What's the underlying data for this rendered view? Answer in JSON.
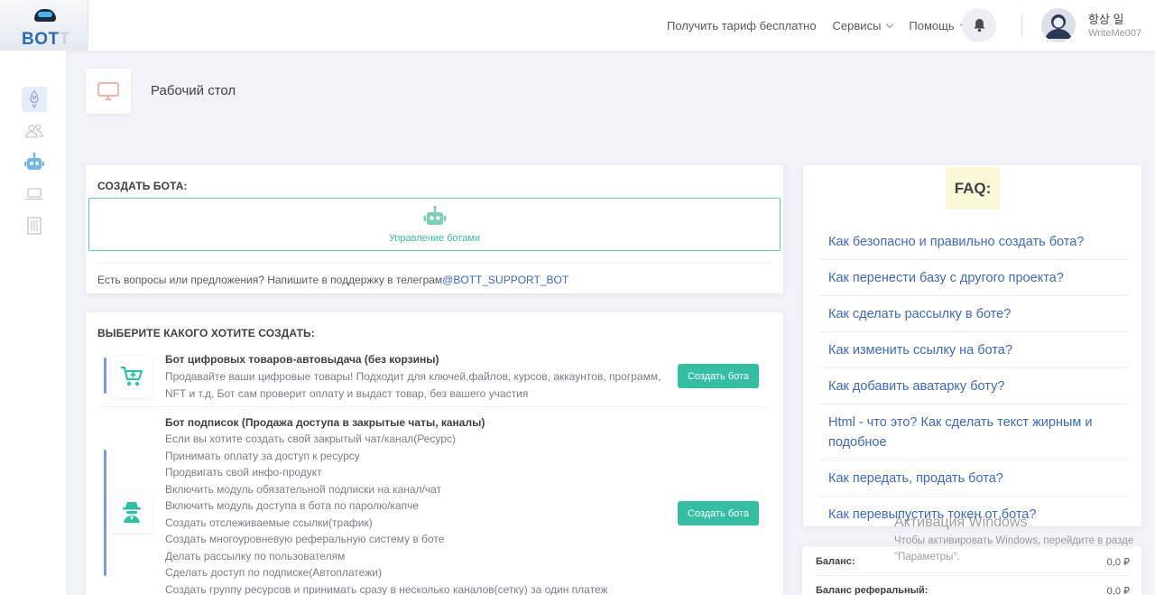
{
  "header": {
    "logo_main": "BOT",
    "logo_tail": "T",
    "nav": {
      "free_tariff": "Получить тариф бесплатно",
      "services": "Сервисы",
      "help": "Помощь"
    },
    "user": {
      "name": "항상 일",
      "login": "WriteMe007"
    }
  },
  "sidebar": {
    "icons": [
      "rocket-icon",
      "users-icon",
      "robot-icon",
      "laptop-icon",
      "building-icon"
    ],
    "active_index": 0
  },
  "page": {
    "title": "Рабочий стол"
  },
  "create_bot": {
    "title": "СОЗДАТЬ БОТА:",
    "manage_label": "Управление ботами",
    "support_text": "Есть вопросы или предложения? Напишите в поддержку в телеграм",
    "support_link": "@BOTT_SUPPORT_BOT"
  },
  "choose": {
    "title": "ВЫБЕРИТЕ КАКОГО ХОТИТЕ СОЗДАТЬ:",
    "bots": [
      {
        "title": "Бот цифровых товаров-автовыдача (без корзины)",
        "desc": [
          "Продавайте ваши цифровые товары! Подходит для ключей,файлов, курсов, аккаунтов, программ,",
          "NFT и т.д, Бот сам проверит оплату и выдаст товар, без вашего участия"
        ],
        "button": "Создать бота"
      },
      {
        "title": "Бот подписок (Продажа доступа в закрытые чаты, каналы)",
        "desc": [
          "Если вы хотите создать свой закрытый чат/канал(Ресурс)",
          "Принимать оплату за доступ к ресурсу",
          "Продвигать свой инфо-продукт",
          "Включить модуль обязательной подписки на канал/чат",
          "Включить модуль доступа в бота по паролю/капче",
          "Создать отслеживаемые ссылки(трафик)",
          "Создать многоуровневую реферальную систему в боте",
          "Делать рассылку по пользователям",
          "Сделать доступ по подписке(Автоплатежи)",
          "Создать группу ресурсов и принимать сразу в несколько каналов(сетку) за один платеж"
        ],
        "button": "Создать бота"
      }
    ]
  },
  "faq": {
    "title": "FAQ:",
    "items": [
      "Как безопасно и правильно создать бота?",
      "Как перенести базу с другого проекта?",
      "Как сделать рассылку в боте?",
      "Как изменить ссылку на бота?",
      "Как добавить аватарку боту?",
      "Html - что это? Как сделать текст жирным и подобное",
      "Как передать, продать бота?",
      "Как перевыпустить токен от бота?"
    ]
  },
  "balance": {
    "rows": [
      {
        "label": "Баланс:",
        "value": "0,0 ₽"
      },
      {
        "label": "Баланс реферальный:",
        "value": "0,0 ₽"
      }
    ]
  },
  "watermark": {
    "title": "Активация Windows",
    "line1": "Чтобы активировать Windows, перейдите в разде",
    "line2": "\"Параметры\"."
  },
  "colors": {
    "accent_green": "#34bfa3",
    "link_blue": "#3d69c4",
    "accent_bar": "#7c9adf",
    "faq_highlight": "#fbf8d7"
  }
}
